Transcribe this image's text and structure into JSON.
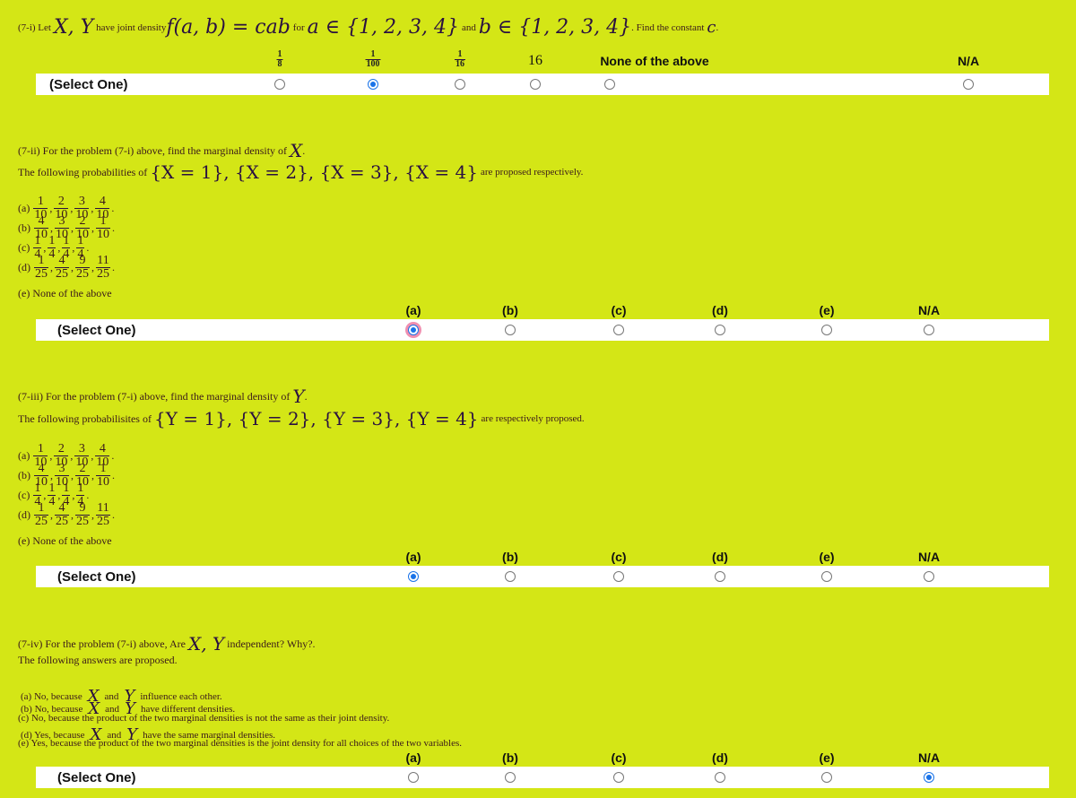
{
  "colors": {
    "background": "#d4e616",
    "radio_checked": "#1a73e8",
    "focus_ring": "#f08fb0",
    "row_bar": "#ffffff"
  },
  "q1": {
    "prefix": "(7-i) Let",
    "vars": "X, Y",
    "mid1": "have joint density",
    "formula": "f(a, b) = cab",
    "mid2": "for",
    "set_a": "a ∈ {1, 2, 3, 4}",
    "mid3": "and",
    "set_b": "b ∈ {1, 2, 3, 4}",
    "suffix": ". Find the constant",
    "const": "c",
    "end": ".",
    "select_label": "(Select One)",
    "options": [
      {
        "num": "1",
        "den": "8",
        "selected": false
      },
      {
        "num": "1",
        "den": "100",
        "selected": true
      },
      {
        "num": "1",
        "den": "16",
        "selected": false
      },
      {
        "label": "16",
        "selected": false
      },
      {
        "label": "None of the above",
        "selected": false
      },
      {
        "label": "N/A",
        "selected": false
      }
    ]
  },
  "q2": {
    "line1_prefix": "(7-ii) For the problem (7-i) above, find the marginal density of",
    "line1_var": "X",
    "line1_end": ".",
    "line2_prefix": "The following probabilities of",
    "line2_sets": "{X = 1}, {X = 2}, {X = 3}, {X = 4}",
    "line2_suffix": "are proposed respectively.",
    "choices": [
      {
        "label": "(a)",
        "fracs": [
          [
            "1",
            "10"
          ],
          [
            "2",
            "10"
          ],
          [
            "3",
            "10"
          ],
          [
            "4",
            "10"
          ]
        ]
      },
      {
        "label": "(b)",
        "fracs": [
          [
            "4",
            "10"
          ],
          [
            "3",
            "10"
          ],
          [
            "2",
            "10"
          ],
          [
            "1",
            "10"
          ]
        ]
      },
      {
        "label": "(c)",
        "fracs": [
          [
            "1",
            "4"
          ],
          [
            "1",
            "4"
          ],
          [
            "1",
            "4"
          ],
          [
            "1",
            "4"
          ]
        ]
      },
      {
        "label": "(d)",
        "fracs": [
          [
            "1",
            "25"
          ],
          [
            "4",
            "25"
          ],
          [
            "9",
            "25"
          ],
          [
            "11",
            "25"
          ]
        ]
      }
    ],
    "choice_e": "(e) None of the above",
    "select_label": "(Select One)",
    "columns": [
      "(a)",
      "(b)",
      "(c)",
      "(d)",
      "(e)",
      "N/A"
    ],
    "selected_index": 0,
    "focused_index": 0
  },
  "q3": {
    "line1_prefix": "(7-iii) For the problem (7-i) above, find the marginal density of",
    "line1_var": "Y",
    "line1_end": ".",
    "line2_prefix": "The following probabilisites of",
    "line2_sets": "{Y = 1}, {Y = 2}, {Y = 3}, {Y = 4}",
    "line2_suffix": "are respectively proposed.",
    "choices": [
      {
        "label": "(a)",
        "fracs": [
          [
            "1",
            "10"
          ],
          [
            "2",
            "10"
          ],
          [
            "3",
            "10"
          ],
          [
            "4",
            "10"
          ]
        ]
      },
      {
        "label": "(b)",
        "fracs": [
          [
            "4",
            "10"
          ],
          [
            "3",
            "10"
          ],
          [
            "2",
            "10"
          ],
          [
            "1",
            "10"
          ]
        ]
      },
      {
        "label": "(c)",
        "fracs": [
          [
            "1",
            "4"
          ],
          [
            "1",
            "4"
          ],
          [
            "1",
            "4"
          ],
          [
            "1",
            "4"
          ]
        ]
      },
      {
        "label": "(d)",
        "fracs": [
          [
            "1",
            "25"
          ],
          [
            "4",
            "25"
          ],
          [
            "9",
            "25"
          ],
          [
            "11",
            "25"
          ]
        ]
      }
    ],
    "choice_e": "(e) None of the above",
    "select_label": "(Select One)",
    "columns": [
      "(a)",
      "(b)",
      "(c)",
      "(d)",
      "(e)",
      "N/A"
    ],
    "selected_index": 0
  },
  "q4": {
    "line1_prefix": "(7-iv) For the problem (7-i) above, Are",
    "line1_vars": "X, Y",
    "line1_suffix": "independent? Why?.",
    "line2": "The following answers are proposed.",
    "answers": [
      {
        "pre": "(a) No, because",
        "x": "X",
        "and": "and",
        "y": "Y",
        "post": "influence each other."
      },
      {
        "pre": "(b) No, because",
        "x": "X",
        "and": "and",
        "y": "Y",
        "post": "have different densities."
      },
      {
        "text": "(c) No, because the product of the two marginal densities is not the same as their joint density."
      },
      {
        "pre": "(d) Yes, because",
        "x": "X",
        "and": "and",
        "y": "Y",
        "post": "have the same marginal densities."
      },
      {
        "text": "(e) Yes, because the product of the two marginal densities is the joint density for all choices of the two variables."
      }
    ],
    "select_label": "(Select One)",
    "columns": [
      "(a)",
      "(b)",
      "(c)",
      "(d)",
      "(e)",
      "N/A"
    ],
    "selected_index": 5
  }
}
